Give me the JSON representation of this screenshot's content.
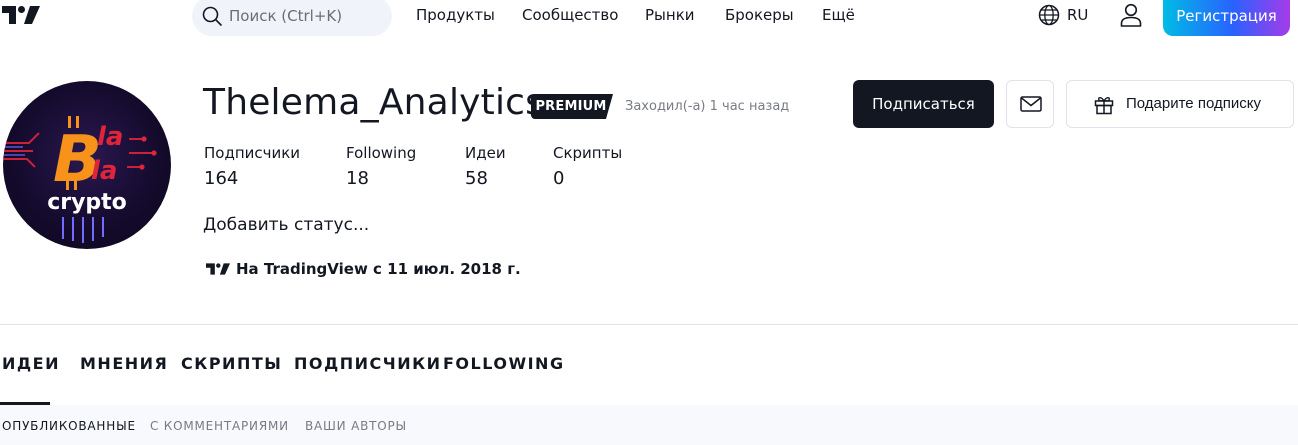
{
  "header": {
    "logo": "tradingview-logo",
    "search": {
      "placeholder": "Поиск (Ctrl+K)",
      "icon": "search-icon"
    },
    "nav": [
      {
        "label": "Продукты"
      },
      {
        "label": "Сообщество"
      },
      {
        "label": "Рынки"
      },
      {
        "label": "Брокеры"
      },
      {
        "label": "Ещё"
      }
    ],
    "language": {
      "label": "RU",
      "icon": "globe-icon"
    },
    "user_icon": "user-icon",
    "register_label": "Регистрация"
  },
  "profile": {
    "avatar": {
      "description_icon": "avatar-logo",
      "text_top": "Bla la",
      "text_bottom": "crypto"
    },
    "username": "Thelema_Analytics",
    "badge": "PREMIUM",
    "last_seen": "Заходил(-а) 1 час назад",
    "actions": {
      "subscribe_label": "Подписаться",
      "message_icon": "mail-icon",
      "gift_label": "Подарите подписку",
      "gift_icon": "gift-icon"
    },
    "stats": [
      {
        "label": "Подписчики",
        "value": "164"
      },
      {
        "label": "Following",
        "value": "18"
      },
      {
        "label": "Идеи",
        "value": "58"
      },
      {
        "label": "Скрипты",
        "value": "0"
      }
    ],
    "status_placeholder": "Добавить статус...",
    "since": "На TradingView с 11 июл. 2018 г."
  },
  "tabs": {
    "items": [
      {
        "label": "ИДЕИ",
        "active": true
      },
      {
        "label": "МНЕНИЯ"
      },
      {
        "label": "СКРИПТЫ"
      },
      {
        "label": "ПОДПИСЧИКИ"
      },
      {
        "label": "FOLLOWING"
      }
    ],
    "subtabs": [
      {
        "label": "ОПУБЛИКОВАННЫЕ",
        "active": true
      },
      {
        "label": "С КОММЕНТАРИЯМИ"
      },
      {
        "label": "ВАШИ АВТОРЫ"
      }
    ]
  },
  "colors": {
    "text": "#131722",
    "muted": "#787b86",
    "border": "#e0e3eb",
    "search_bg": "#f0f3fa",
    "register_gradient": [
      "#00bce5",
      "#2962ff",
      "#a53be8"
    ],
    "bitcoin_orange": "#f7931a",
    "avatar_red": "#e0243a"
  }
}
